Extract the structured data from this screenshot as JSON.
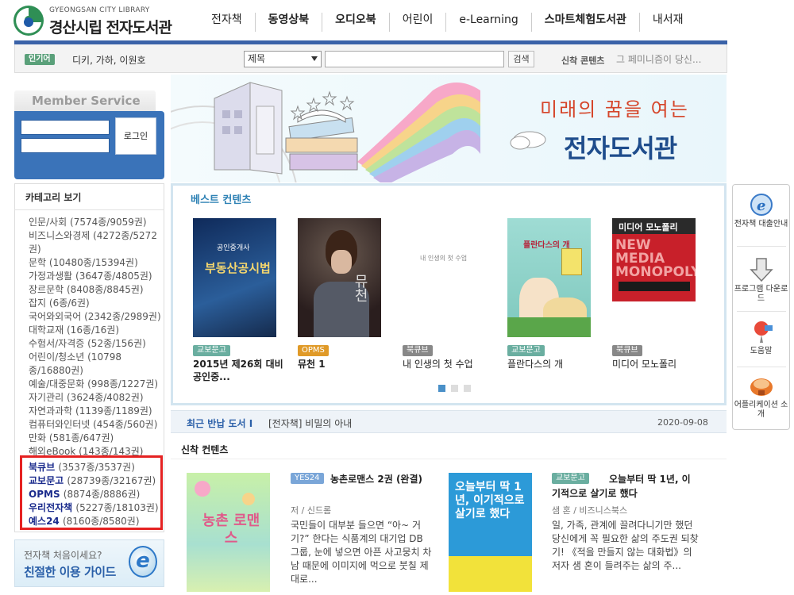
{
  "header": {
    "logo_sub": "GYEONGSAN CITY LIBRARY",
    "logo_main": "경산시립 전자도서관",
    "nav": [
      {
        "label": "전자책",
        "bold": false
      },
      {
        "label": "동영상북",
        "bold": true
      },
      {
        "label": "오디오북",
        "bold": true
      },
      {
        "label": "어린이",
        "bold": false
      },
      {
        "label": "e-Learning",
        "bold": false
      },
      {
        "label": "스마트체험도서관",
        "bold": true
      },
      {
        "label": "내서재",
        "bold": false
      }
    ]
  },
  "search": {
    "popular_badge": "인기어",
    "popular_terms": "디키, 가하, 이원호",
    "select_value": "제목",
    "button": "검색",
    "new_label": "신착 콘텐츠",
    "new_ticker": "그 페미니즘이 당신..."
  },
  "member": {
    "title": "Member Service",
    "login_button": "로그인"
  },
  "banner": {
    "line1": "미래의 꿈을 여는",
    "line2": "전자도서관"
  },
  "category": {
    "title": "카테고리 보기",
    "items": [
      {
        "name": "인문/사회",
        "count": "(7574종/9059권)"
      },
      {
        "name": "비즈니스와경제",
        "count": "(4272종/5272권)"
      },
      {
        "name": "문학",
        "count": "(10480종/15394권)"
      },
      {
        "name": "가정과생활",
        "count": "(3647종/4805권)"
      },
      {
        "name": "장르문학",
        "count": "(8408종/8845권)"
      },
      {
        "name": "잡지",
        "count": "(6종/6권)"
      },
      {
        "name": "국어와외국어",
        "count": "(2342종/2989권)"
      },
      {
        "name": "대학교재",
        "count": "(16종/16권)"
      },
      {
        "name": "수험서/자격증",
        "count": "(52종/156권)"
      },
      {
        "name": "어린이/청소년",
        "count": "(10798종/16880권)"
      },
      {
        "name": "예술/대중문화",
        "count": "(998종/1227권)"
      },
      {
        "name": "자기관리",
        "count": "(3624종/4082권)"
      },
      {
        "name": "자연과과학",
        "count": "(1139종/1189권)"
      },
      {
        "name": "컴퓨터와인터넷",
        "count": "(454종/560권)"
      },
      {
        "name": "만화",
        "count": "(581종/647권)"
      },
      {
        "name": "해외eBook",
        "count": "(143종/143권)"
      }
    ],
    "providers": [
      {
        "name": "북큐브",
        "count": "(3537종/3537권)"
      },
      {
        "name": "교보문고",
        "count": "(28739종/32167권)"
      },
      {
        "name": "OPMS",
        "count": "(8874종/8886권)"
      },
      {
        "name": "우리전자책",
        "count": "(5227종/18103권)"
      },
      {
        "name": "예스24",
        "count": "(8160종/8580권)"
      }
    ]
  },
  "guide": {
    "line1": "전자책 처음이세요?",
    "line2": "친절한 이용 가이드"
  },
  "best": {
    "title": "베스트 컨텐츠",
    "books": [
      {
        "badge": "교보문고",
        "title": "2015년 제26회 대비 공인중...",
        "cover_text": "부동산공시법",
        "cover_sub": "공인중개사",
        "color": "#1e3b6e"
      },
      {
        "badge": "OPMS",
        "title": "뮤천 1",
        "cover_text": "뮤천",
        "cover_sub": "",
        "color": "#3a2a2a"
      },
      {
        "badge": "북큐브",
        "title": "내 인생의 첫 수업",
        "cover_text": "내 인생의 첫 수업",
        "cover_sub": "",
        "color": "#ffffff"
      },
      {
        "badge": "교보문고",
        "title": "플란다스의 개",
        "cover_text": "플란다스의 개",
        "cover_sub": "",
        "color": "#8fd0c8"
      },
      {
        "badge": "북큐브",
        "title": "미디어 모노폴리",
        "cover_text": "NEW MEDIA MONOPOLY",
        "cover_sub": "미디어 모노폴리",
        "color": "#c8202a"
      }
    ]
  },
  "recent": {
    "label": "최근 반납 도서 I",
    "text": "[전자책] 비밀의 아내",
    "date": "2020-09-08"
  },
  "new_contents": {
    "title": "신착 컨텐츠",
    "items": [
      {
        "badge": "YES24",
        "title": "농촌로맨스 2권 (완결)",
        "author": "저 / 신드롬",
        "desc": "국민들이 대부분 들으면 “아~ 거기?” 한다는 식품계의 대기업 DB 그룹, 눈에 넣으면 아픈 사고뭉치 차남 때문에 이미지에 먹으로 붓칠 제대로...",
        "cover_text": "농촌 로맨스"
      },
      {
        "badge": "교보문고",
        "title": "오늘부터 딱 1년, 이기적으로 살기로 했다",
        "author": "샘 혼 / 비즈니스북스",
        "desc": "일, 가족, 관계에 끌려다니기만 했던 당신에게 꼭 필요한 삶의 주도권 되찾기! 《적을 만들지 않는 대화법》의 저자 샘 혼이 들려주는 삶의 주...",
        "cover_text": "오늘부터 딱 1년, 이기적으로 살기로 했다"
      }
    ]
  },
  "quick_menu": [
    {
      "label": "전자책 대출안내",
      "icon": "ie-globe-icon"
    },
    {
      "label": "프로그램 다운로드",
      "icon": "download-arrow-icon"
    },
    {
      "label": "도움말",
      "icon": "help-pin-icon"
    },
    {
      "label": "어플리케이션 소개",
      "icon": "app-icon"
    }
  ],
  "colors": {
    "accent_blue": "#3a62a8",
    "member_blue": "#3a73b9",
    "highlight_red": "#e52222",
    "best_title": "#2f82b5"
  }
}
